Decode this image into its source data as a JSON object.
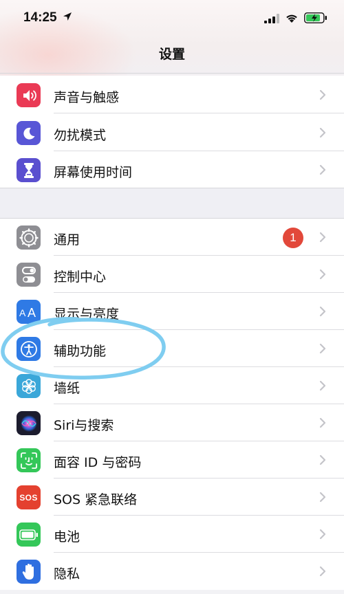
{
  "status_bar": {
    "time": "14:25",
    "icons": [
      "location-arrow-icon",
      "cellular-signal-icon",
      "wifi-icon",
      "battery-charging-icon"
    ]
  },
  "nav": {
    "title": "设置"
  },
  "group1": [
    {
      "label": "声音与触感",
      "icon": "speaker-icon",
      "color": "#ea3a55"
    },
    {
      "label": "勿扰模式",
      "icon": "moon-icon",
      "color": "#5856d6"
    },
    {
      "label": "屏幕使用时间",
      "icon": "hourglass-icon",
      "color": "#5a4fcf"
    }
  ],
  "group2": [
    {
      "label": "通用",
      "icon": "gear-icon",
      "color": "#8e8e93",
      "badge": "1"
    },
    {
      "label": "控制中心",
      "icon": "toggles-icon",
      "color": "#8e8e93"
    },
    {
      "label": "显示与亮度",
      "icon": "text-size-icon",
      "color": "#2f7ae5"
    },
    {
      "label": "辅助功能",
      "icon": "accessibility-icon",
      "color": "#2f7ae5"
    },
    {
      "label": "墙纸",
      "icon": "flower-icon",
      "color": "#3aa7d9"
    },
    {
      "label": "Siri与搜索",
      "icon": "siri-icon",
      "color": "#1c1c2e"
    },
    {
      "label": "面容 ID 与密码",
      "icon": "face-id-icon",
      "color": "#34c759"
    },
    {
      "label": "SOS 紧急联络",
      "icon": "sos-icon",
      "sos_text": "SOS",
      "color": "#e4412f"
    },
    {
      "label": "电池",
      "icon": "battery-icon",
      "color": "#34c759"
    },
    {
      "label": "隐私",
      "icon": "hand-icon",
      "color": "#2f6fe0"
    }
  ],
  "annotation": {
    "color": "#7fcdf0",
    "target": "辅助功能"
  }
}
